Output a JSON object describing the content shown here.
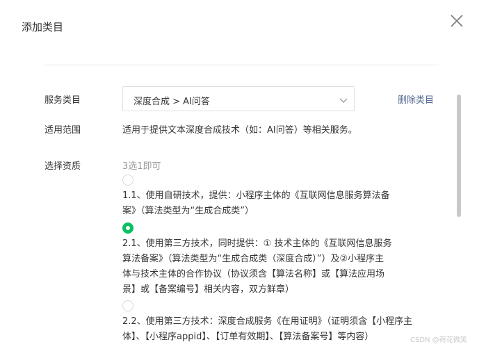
{
  "dialog": {
    "title": "添加类目",
    "close_icon": "close-icon"
  },
  "service": {
    "label": "服务类目",
    "selected_value": "深度合成 > AI问答",
    "chevron_icon": "chevron-down-icon",
    "delete_label": "删除类目"
  },
  "scope": {
    "label": "适用范围",
    "text": "适用于提供文本深度合成技术（如：AI问答）等相关服务。"
  },
  "qualification": {
    "label": "选择资质",
    "hint": "3选1即可",
    "options": [
      {
        "checked": false,
        "lines": [
          "1.1、使用自研技术，提供：小程序主体的《互联网信息服务算法备",
          "案》（算法类型为“生成合成类”）"
        ]
      },
      {
        "checked": true,
        "lines": [
          "2.1、使用第三方技术，同时提供：① 技术主体的《互联网信息服务",
          "算法备案》（算法类型为“生成合成类（深度合成）”）及②小程序主",
          "体与技术主体的合作协议（协议须含【算法名称】或【算法应用场",
          "景】或【备案编号】相关内容，双方鲜章）"
        ]
      },
      {
        "checked": false,
        "lines": [
          "2.2、使用第三方技术：深度合成服务《在用证明》（证明须含【小程序主",
          "体】、【小程序appid】、【订单有效期】、【算法备案号】等内容）"
        ]
      }
    ]
  },
  "watermark": "CSDN @荷花微笑",
  "colors": {
    "accent_green": "#07c160",
    "link_blue": "#576b95"
  }
}
